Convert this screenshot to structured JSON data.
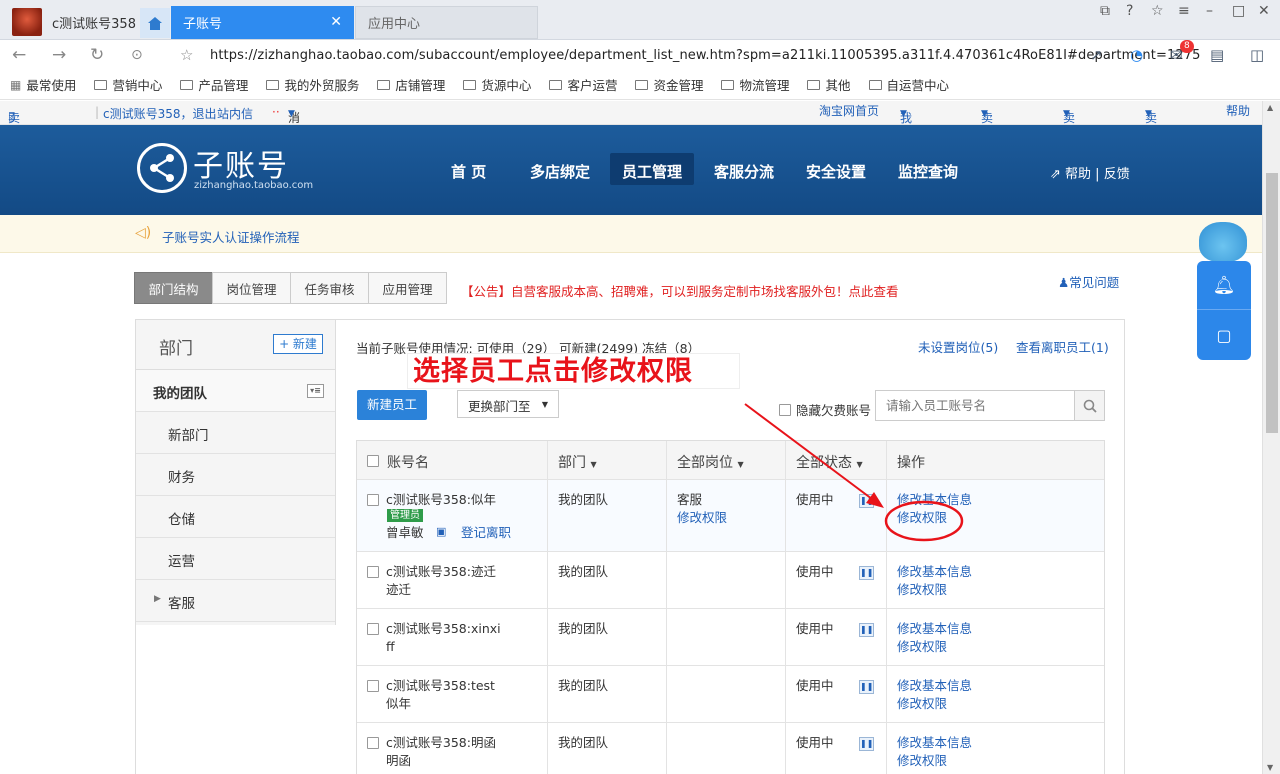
{
  "window": {
    "account_title": "c测试账号358",
    "tabs": [
      {
        "label": "子账号"
      },
      {
        "label": "应用中心"
      }
    ]
  },
  "address_bar": {
    "url": "https://zizhanghao.taobao.com/subaccount/employee/department_list_new.htm?spm=a211ki.11005395.a311f.4.470361c4RoE81I#department=1275",
    "mail_badge": "8"
  },
  "bookmarks": [
    "最常使用",
    "营销中心",
    "产品管理",
    "我的外贸服务",
    "店铺管理",
    "货源中心",
    "客户运营",
    "资金管理",
    "物流管理",
    "其他",
    "自运营中心"
  ],
  "taobao_bar": {
    "mobile": "卖家手机端",
    "user": "c测试账号358，退出",
    "inbox": "站内信",
    "messages": "消息",
    "links": [
      "淘宝网首页",
      "我的淘宝",
      "卖家中心",
      "卖家服务",
      "卖家地图",
      "帮助"
    ]
  },
  "header": {
    "logo_title": "子账号",
    "logo_sub": "zizhanghao.taobao.com",
    "nav": [
      "首 页",
      "多店绑定",
      "员工管理",
      "客服分流",
      "安全设置",
      "监控查询"
    ],
    "help": "帮助 | 反馈"
  },
  "notice": "子账号实人认证操作流程",
  "subtabs": [
    "部门结构",
    "岗位管理",
    "任务审核",
    "应用管理"
  ],
  "announcement": "【公告】自营客服成本高、招聘难，可以到服务定制市场找客服外包！点此查看",
  "faq": "常见问题",
  "sidebar": {
    "title": "部门",
    "new_button": "+ 新建",
    "team": "我的团队",
    "depts": [
      "新部门",
      "财务",
      "仓储",
      "运营",
      "客服"
    ]
  },
  "stats": {
    "text": "当前子账号使用情况:  可使用（29）   可新建(2499)    冻结（8）",
    "unset_position": "未设置岗位(5)",
    "departed": "查看离职员工(1)"
  },
  "annotation": "选择员工点击修改权限",
  "toolbar": {
    "new_employee": "新建员工",
    "change_dept": "更换部门至",
    "hide_arrears": "隐藏欠费账号",
    "search_placeholder": "请输入员工账号名"
  },
  "table": {
    "headers": [
      "账号名",
      "部门",
      "全部岗位",
      "全部状态",
      "操作"
    ],
    "rows": [
      {
        "account": "c测试账号358:似年",
        "account2": "",
        "admin": "管理员",
        "name": "曾卓敏",
        "register": "登记离职",
        "dept": "我的团队",
        "position": "客服",
        "perm_link": "修改权限",
        "status": "使用中",
        "op1": "修改基本信息",
        "op2": "修改权限"
      },
      {
        "account": "c测试账号358:迹迁",
        "account2": "迹迁",
        "dept": "我的团队",
        "status": "使用中",
        "op1": "修改基本信息",
        "op2": "修改权限"
      },
      {
        "account": "c测试账号358:xinxi",
        "account2": "ff",
        "dept": "我的团队",
        "status": "使用中",
        "op1": "修改基本信息",
        "op2": "修改权限"
      },
      {
        "account": "c测试账号358:test",
        "account2": "似年",
        "dept": "我的团队",
        "status": "使用中",
        "op1": "修改基本信息",
        "op2": "修改权限"
      },
      {
        "account": "c测试账号358:明函",
        "account2": "明函",
        "dept": "我的团队",
        "status": "使用中",
        "op1": "修改基本信息",
        "op2": "修改权限"
      }
    ]
  },
  "colors": {
    "header_blue": "#1d5c9c",
    "link": "#2261b8",
    "annotation_red": "#e8131a",
    "tab_active": "#2e8bf0"
  }
}
